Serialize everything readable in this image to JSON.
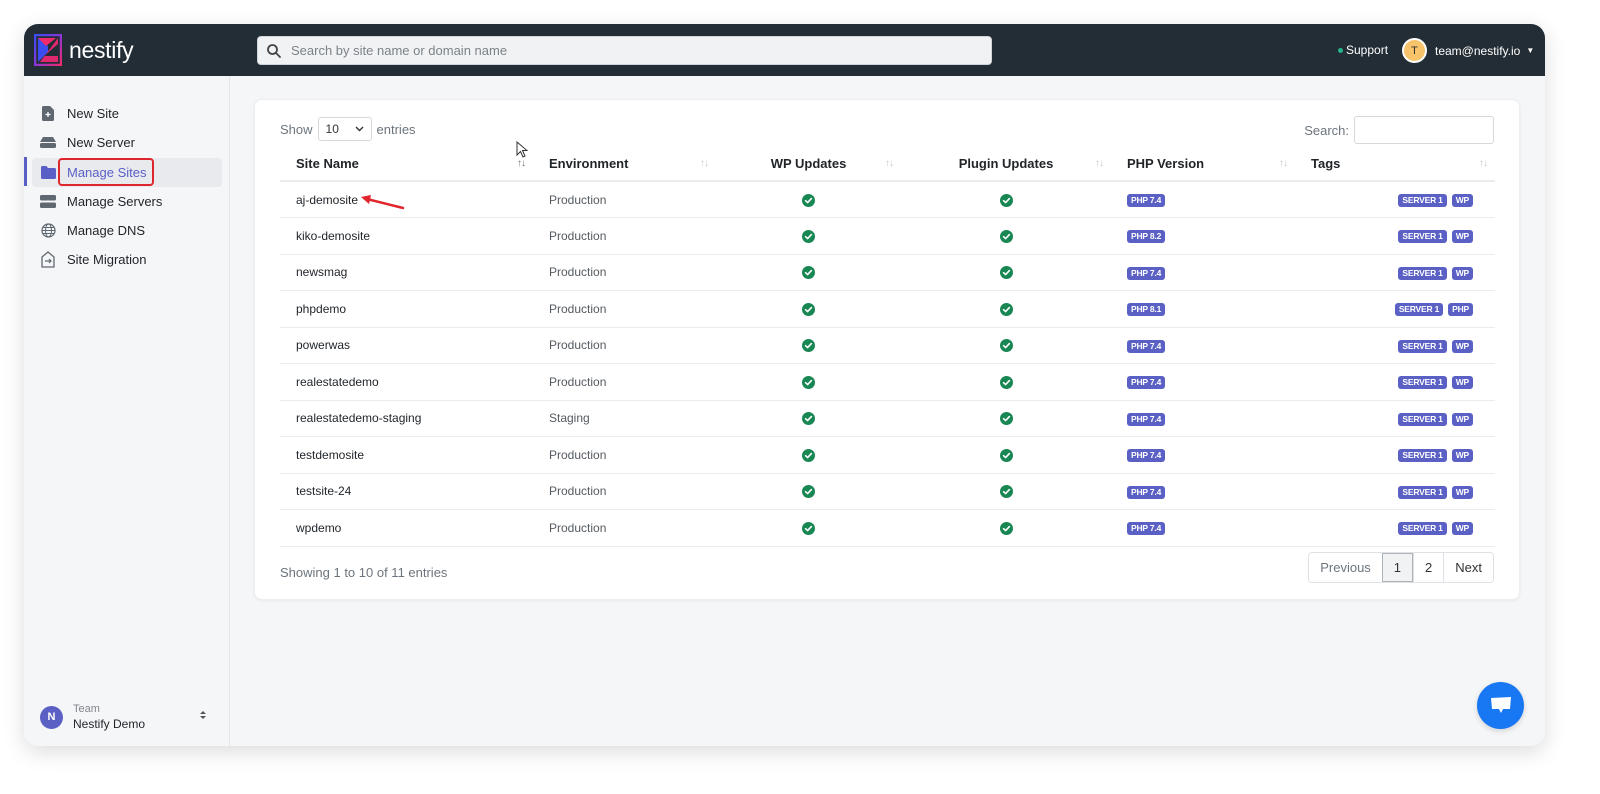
{
  "app": {
    "brand": "nestify",
    "search_placeholder": "Search by site name or domain name",
    "support_label": "Support",
    "user_initial": "T",
    "user_email": "team@nestify.io"
  },
  "sidebar": {
    "items": [
      {
        "label": "New Site",
        "icon": "file-plus-icon"
      },
      {
        "label": "New Server",
        "icon": "server-icon"
      },
      {
        "label": "Manage Sites",
        "icon": "folder-icon",
        "active": true
      },
      {
        "label": "Manage Servers",
        "icon": "servers-icon"
      },
      {
        "label": "Manage DNS",
        "icon": "globe-icon"
      },
      {
        "label": "Site Migration",
        "icon": "migration-icon"
      }
    ],
    "team": {
      "label": "Team",
      "name": "Nestify Demo",
      "initial": "N"
    }
  },
  "table": {
    "show_label": "Show",
    "entries_label": "entries",
    "page_size": "10",
    "search_label": "Search:",
    "search_value": "",
    "columns": [
      "Site Name",
      "Environment",
      "WP Updates",
      "Plugin Updates",
      "PHP Version",
      "Tags"
    ],
    "rows": [
      {
        "site": "aj-demosite",
        "env": "Production",
        "wp_ok": true,
        "plugin_ok": true,
        "php": "PHP 7.4",
        "tags": [
          "SERVER 1",
          "WP"
        ]
      },
      {
        "site": "kiko-demosite",
        "env": "Production",
        "wp_ok": true,
        "plugin_ok": true,
        "php": "PHP 8.2",
        "tags": [
          "SERVER 1",
          "WP"
        ]
      },
      {
        "site": "newsmag",
        "env": "Production",
        "wp_ok": true,
        "plugin_ok": true,
        "php": "PHP 7.4",
        "tags": [
          "SERVER 1",
          "WP"
        ]
      },
      {
        "site": "phpdemo",
        "env": "Production",
        "wp_ok": true,
        "plugin_ok": true,
        "php": "PHP 8.1",
        "tags": [
          "SERVER 1",
          "PHP"
        ]
      },
      {
        "site": "powerwas",
        "env": "Production",
        "wp_ok": true,
        "plugin_ok": true,
        "php": "PHP 7.4",
        "tags": [
          "SERVER 1",
          "WP"
        ]
      },
      {
        "site": "realestatedemo",
        "env": "Production",
        "wp_ok": true,
        "plugin_ok": true,
        "php": "PHP 7.4",
        "tags": [
          "SERVER 1",
          "WP"
        ]
      },
      {
        "site": "realestatedemo-staging",
        "env": "Staging",
        "wp_ok": true,
        "plugin_ok": true,
        "php": "PHP 7.4",
        "tags": [
          "SERVER 1",
          "WP"
        ]
      },
      {
        "site": "testdemosite",
        "env": "Production",
        "wp_ok": true,
        "plugin_ok": true,
        "php": "PHP 7.4",
        "tags": [
          "SERVER 1",
          "WP"
        ]
      },
      {
        "site": "testsite-24",
        "env": "Production",
        "wp_ok": true,
        "plugin_ok": true,
        "php": "PHP 7.4",
        "tags": [
          "SERVER 1",
          "WP"
        ]
      },
      {
        "site": "wpdemo",
        "env": "Production",
        "wp_ok": true,
        "plugin_ok": true,
        "php": "PHP 7.4",
        "tags": [
          "SERVER 1",
          "WP"
        ]
      }
    ],
    "showing_text": "Showing 1 to 10 of 11 entries",
    "pagination": {
      "previous": "Previous",
      "pages": [
        "1",
        "2"
      ],
      "current": "1",
      "next": "Next"
    }
  },
  "colors": {
    "accent": "#5a60c4",
    "topbar": "#232d35",
    "success": "#198754",
    "annotation": "#e0262d",
    "chat": "#1877f2"
  }
}
